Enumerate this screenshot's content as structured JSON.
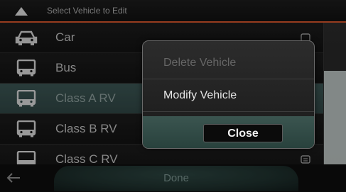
{
  "header": {
    "title": "Select Vehicle to Edit",
    "up_icon": "triangle-up-icon"
  },
  "vehicles": [
    {
      "label": "Car",
      "icon": "car-icon"
    },
    {
      "label": "Bus",
      "icon": "bus-icon"
    },
    {
      "label": "Class A RV",
      "icon": "bus-icon"
    },
    {
      "label": "Class B RV",
      "icon": "bus-icon"
    },
    {
      "label": "Class C RV",
      "icon": "bus-icon"
    }
  ],
  "footer": {
    "done_label": "Done",
    "back_icon": "back-arrow-icon"
  },
  "popup": {
    "delete_label": "Delete Vehicle",
    "modify_label": "Modify Vehicle",
    "close_label": "Close"
  },
  "colors": {
    "accent": "#d2542b",
    "selection": "#3a5452",
    "popup_footer": "#3b5550"
  }
}
